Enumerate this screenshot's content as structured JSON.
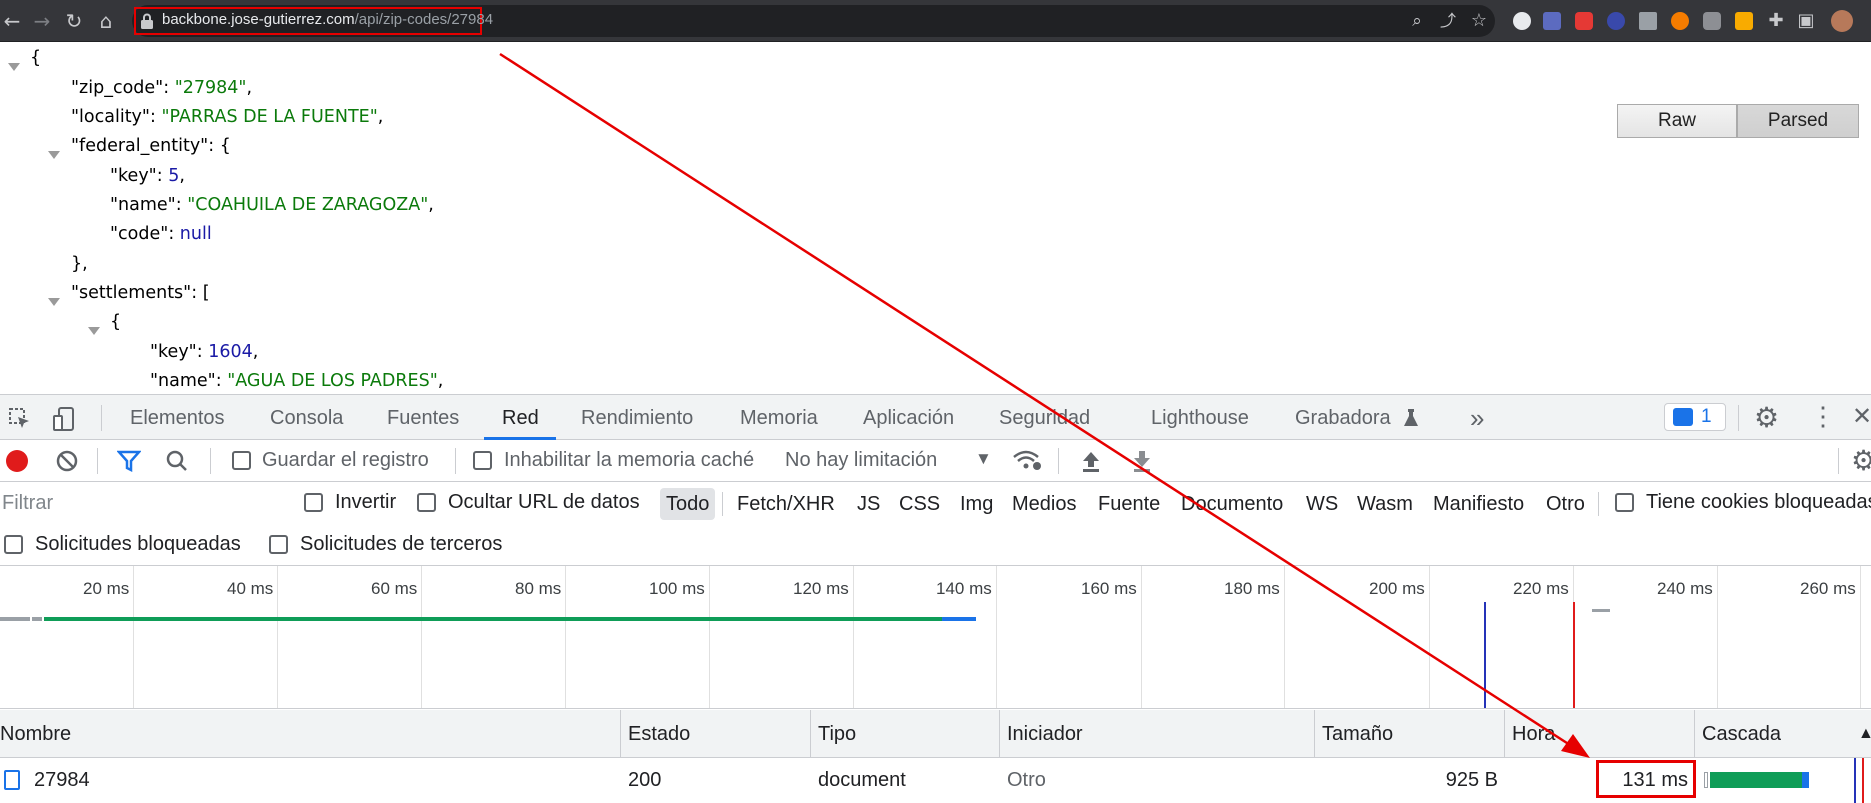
{
  "browser": {
    "url_host": "backbone.jose-gutierrez.com",
    "url_path": "/api/zip-codes/27984",
    "nav_icons": [
      "back-icon",
      "forward-icon",
      "reload-icon",
      "home-icon"
    ],
    "right_icons": [
      "zoom-icon",
      "share-icon",
      "bookmark-star-icon",
      "extensions-icon",
      "sidebar-icon",
      "profile-avatar"
    ]
  },
  "json_view": {
    "buttons": {
      "raw": "Raw",
      "parsed": "Parsed"
    },
    "lines": {
      "open_brace": "{",
      "zip_code_key": "\"zip_code\"",
      "zip_code_val": "\"27984\"",
      "locality_key": "\"locality\"",
      "locality_val": "\"PARRAS DE LA FUENTE\"",
      "federal_entity_key": "\"federal_entity\"",
      "fe_key_key": "\"key\"",
      "fe_key_val": "5",
      "fe_name_key": "\"name\"",
      "fe_name_val": "\"COAHUILA DE ZARAGOZA\"",
      "fe_code_key": "\"code\"",
      "fe_code_val": "null",
      "close_obj": "},",
      "settlements_key": "\"settlements\"",
      "settlements_open": "[",
      "item_open": "{",
      "s_key_key": "\"key\"",
      "s_key_val": "1604",
      "s_name_key": "\"name\"",
      "s_name_val": "\"AGUA DE LOS PADRES\""
    }
  },
  "devtools": {
    "tabs": [
      "Elementos",
      "Consola",
      "Fuentes",
      "Red",
      "Rendimiento",
      "Memoria",
      "Aplicación",
      "Seguridad",
      "Lighthouse",
      "Grabadora"
    ],
    "more_tabs": "»",
    "active_tab": "Red",
    "messages_count": "1",
    "controls": {
      "preserve_log": "Guardar el registro",
      "disable_cache": "Inhabilitar la memoria caché",
      "throttling": "No hay limitación"
    },
    "filter": {
      "placeholder": "Filtrar",
      "invert": "Invertir",
      "hide_data_urls": "Ocultar URL de datos",
      "types": [
        "Todo",
        "Fetch/XHR",
        "JS",
        "CSS",
        "Img",
        "Medios",
        "Fuente",
        "Documento",
        "WS",
        "Wasm",
        "Manifiesto",
        "Otro"
      ],
      "blocked_cookies": "Tiene cookies bloqueadas",
      "blocked_requests": "Solicitudes bloqueadas",
      "third_party": "Solicitudes de terceros"
    },
    "overview_ticks": [
      "20 ms",
      "40 ms",
      "60 ms",
      "80 ms",
      "100 ms",
      "120 ms",
      "140 ms",
      "160 ms",
      "180 ms",
      "200 ms",
      "220 ms",
      "240 ms",
      "260 ms"
    ],
    "table": {
      "headers": {
        "name": "Nombre",
        "status": "Estado",
        "type": "Tipo",
        "initiator": "Iniciador",
        "size": "Tamaño",
        "time": "Hora",
        "waterfall": "Cascada"
      },
      "row": {
        "name": "27984",
        "status": "200",
        "type": "document",
        "initiator": "Otro",
        "size": "925 B",
        "time": "131 ms"
      }
    }
  },
  "colors": {
    "annotation": "#e60000",
    "json_string": "#0b7a0b",
    "json_number": "#1a1aa6",
    "accent": "#1a73e8",
    "waterfall_green": "#0f9d58"
  }
}
